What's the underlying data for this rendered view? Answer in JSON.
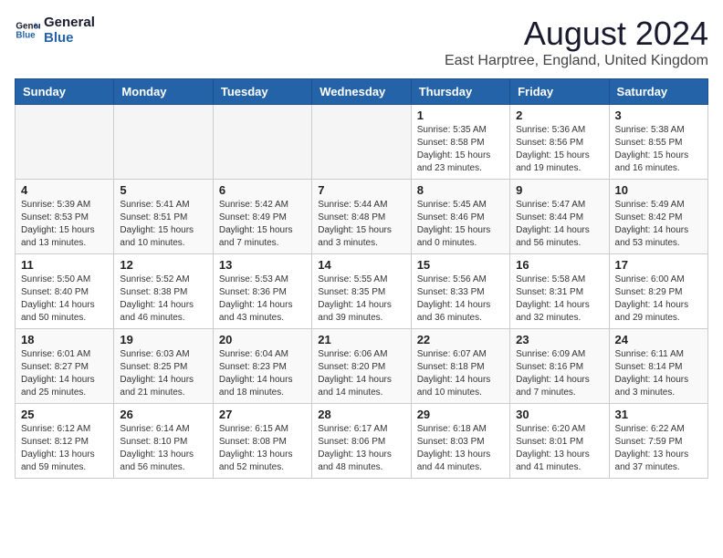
{
  "logo": {
    "line1": "General",
    "line2": "Blue"
  },
  "title": "August 2024",
  "subtitle": "East Harptree, England, United Kingdom",
  "days_of_week": [
    "Sunday",
    "Monday",
    "Tuesday",
    "Wednesday",
    "Thursday",
    "Friday",
    "Saturday"
  ],
  "weeks": [
    [
      {
        "day": "",
        "info": ""
      },
      {
        "day": "",
        "info": ""
      },
      {
        "day": "",
        "info": ""
      },
      {
        "day": "",
        "info": ""
      },
      {
        "day": "1",
        "info": "Sunrise: 5:35 AM\nSunset: 8:58 PM\nDaylight: 15 hours\nand 23 minutes."
      },
      {
        "day": "2",
        "info": "Sunrise: 5:36 AM\nSunset: 8:56 PM\nDaylight: 15 hours\nand 19 minutes."
      },
      {
        "day": "3",
        "info": "Sunrise: 5:38 AM\nSunset: 8:55 PM\nDaylight: 15 hours\nand 16 minutes."
      }
    ],
    [
      {
        "day": "4",
        "info": "Sunrise: 5:39 AM\nSunset: 8:53 PM\nDaylight: 15 hours\nand 13 minutes."
      },
      {
        "day": "5",
        "info": "Sunrise: 5:41 AM\nSunset: 8:51 PM\nDaylight: 15 hours\nand 10 minutes."
      },
      {
        "day": "6",
        "info": "Sunrise: 5:42 AM\nSunset: 8:49 PM\nDaylight: 15 hours\nand 7 minutes."
      },
      {
        "day": "7",
        "info": "Sunrise: 5:44 AM\nSunset: 8:48 PM\nDaylight: 15 hours\nand 3 minutes."
      },
      {
        "day": "8",
        "info": "Sunrise: 5:45 AM\nSunset: 8:46 PM\nDaylight: 15 hours\nand 0 minutes."
      },
      {
        "day": "9",
        "info": "Sunrise: 5:47 AM\nSunset: 8:44 PM\nDaylight: 14 hours\nand 56 minutes."
      },
      {
        "day": "10",
        "info": "Sunrise: 5:49 AM\nSunset: 8:42 PM\nDaylight: 14 hours\nand 53 minutes."
      }
    ],
    [
      {
        "day": "11",
        "info": "Sunrise: 5:50 AM\nSunset: 8:40 PM\nDaylight: 14 hours\nand 50 minutes."
      },
      {
        "day": "12",
        "info": "Sunrise: 5:52 AM\nSunset: 8:38 PM\nDaylight: 14 hours\nand 46 minutes."
      },
      {
        "day": "13",
        "info": "Sunrise: 5:53 AM\nSunset: 8:36 PM\nDaylight: 14 hours\nand 43 minutes."
      },
      {
        "day": "14",
        "info": "Sunrise: 5:55 AM\nSunset: 8:35 PM\nDaylight: 14 hours\nand 39 minutes."
      },
      {
        "day": "15",
        "info": "Sunrise: 5:56 AM\nSunset: 8:33 PM\nDaylight: 14 hours\nand 36 minutes."
      },
      {
        "day": "16",
        "info": "Sunrise: 5:58 AM\nSunset: 8:31 PM\nDaylight: 14 hours\nand 32 minutes."
      },
      {
        "day": "17",
        "info": "Sunrise: 6:00 AM\nSunset: 8:29 PM\nDaylight: 14 hours\nand 29 minutes."
      }
    ],
    [
      {
        "day": "18",
        "info": "Sunrise: 6:01 AM\nSunset: 8:27 PM\nDaylight: 14 hours\nand 25 minutes."
      },
      {
        "day": "19",
        "info": "Sunrise: 6:03 AM\nSunset: 8:25 PM\nDaylight: 14 hours\nand 21 minutes."
      },
      {
        "day": "20",
        "info": "Sunrise: 6:04 AM\nSunset: 8:23 PM\nDaylight: 14 hours\nand 18 minutes."
      },
      {
        "day": "21",
        "info": "Sunrise: 6:06 AM\nSunset: 8:20 PM\nDaylight: 14 hours\nand 14 minutes."
      },
      {
        "day": "22",
        "info": "Sunrise: 6:07 AM\nSunset: 8:18 PM\nDaylight: 14 hours\nand 10 minutes."
      },
      {
        "day": "23",
        "info": "Sunrise: 6:09 AM\nSunset: 8:16 PM\nDaylight: 14 hours\nand 7 minutes."
      },
      {
        "day": "24",
        "info": "Sunrise: 6:11 AM\nSunset: 8:14 PM\nDaylight: 14 hours\nand 3 minutes."
      }
    ],
    [
      {
        "day": "25",
        "info": "Sunrise: 6:12 AM\nSunset: 8:12 PM\nDaylight: 13 hours\nand 59 minutes."
      },
      {
        "day": "26",
        "info": "Sunrise: 6:14 AM\nSunset: 8:10 PM\nDaylight: 13 hours\nand 56 minutes."
      },
      {
        "day": "27",
        "info": "Sunrise: 6:15 AM\nSunset: 8:08 PM\nDaylight: 13 hours\nand 52 minutes."
      },
      {
        "day": "28",
        "info": "Sunrise: 6:17 AM\nSunset: 8:06 PM\nDaylight: 13 hours\nand 48 minutes."
      },
      {
        "day": "29",
        "info": "Sunrise: 6:18 AM\nSunset: 8:03 PM\nDaylight: 13 hours\nand 44 minutes."
      },
      {
        "day": "30",
        "info": "Sunrise: 6:20 AM\nSunset: 8:01 PM\nDaylight: 13 hours\nand 41 minutes."
      },
      {
        "day": "31",
        "info": "Sunrise: 6:22 AM\nSunset: 7:59 PM\nDaylight: 13 hours\nand 37 minutes."
      }
    ]
  ]
}
